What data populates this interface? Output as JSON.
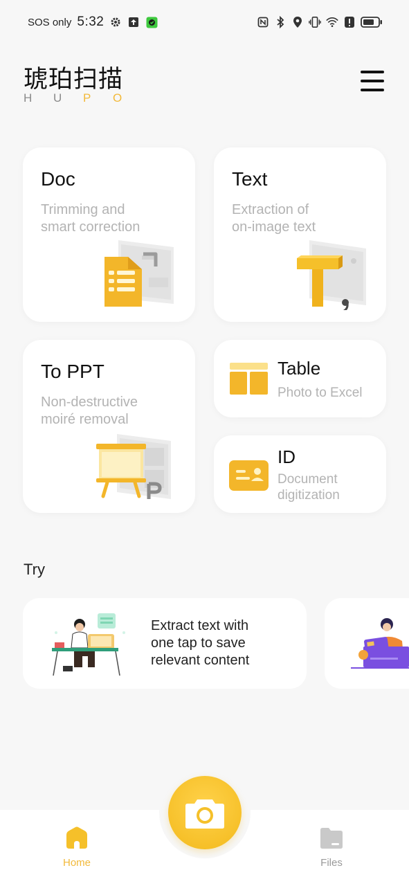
{
  "status_bar": {
    "carrier": "SOS only",
    "time": "5:32"
  },
  "header": {
    "app_title": "琥珀扫描",
    "brand_letters": [
      "H",
      "U",
      "P",
      "O"
    ],
    "colors": {
      "letter_gray": "#8a8a8a",
      "letter_gold": "#f2b93a"
    }
  },
  "features": {
    "doc": {
      "title": "Doc",
      "subtitle_line1": "Trimming and",
      "subtitle_line2": "smart correction"
    },
    "text": {
      "title": "Text",
      "subtitle_line1": "Extraction of",
      "subtitle_line2": "on-image text"
    },
    "ppt": {
      "title": "To PPT",
      "subtitle_line1": "Non-destructive",
      "subtitle_line2": "moiré removal"
    },
    "table": {
      "title": "Table",
      "subtitle": "Photo to Excel"
    },
    "id": {
      "title": "ID",
      "subtitle_line1": "Document",
      "subtitle_line2": "digitization"
    }
  },
  "try_section": {
    "title": "Try",
    "cards": [
      {
        "line1": "Extract text with",
        "line2": "one tap to save",
        "line3": "relevant content"
      }
    ]
  },
  "bottom_nav": {
    "home_label": "Home",
    "files_label": "Files",
    "colors": {
      "active": "#f2b93a",
      "inactive": "#9a9a9a"
    }
  },
  "theme": {
    "accent": "#f5c02a",
    "card_bg": "#ffffff",
    "page_bg": "#f7f7f7"
  }
}
